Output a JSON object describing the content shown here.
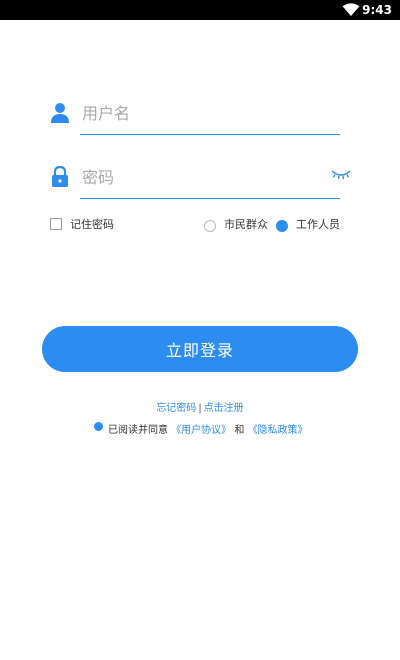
{
  "status_bar": {
    "time": "9:43"
  },
  "form": {
    "username_placeholder": "用户名",
    "password_placeholder": "密码",
    "remember_label": "记住密码",
    "role_options": [
      {
        "label": "市民群众",
        "selected": false
      },
      {
        "label": "工作人员",
        "selected": true
      }
    ],
    "login_button": "立即登录",
    "forgot_link": "忘记密码",
    "separator": "|",
    "register_link": "点击注册",
    "agree_prefix": "已阅读并同意",
    "user_agreement": "《用户协议》",
    "and_word": "和",
    "privacy_policy": "《隐私政策》"
  },
  "colors": {
    "accent": "#2d8cf0"
  }
}
